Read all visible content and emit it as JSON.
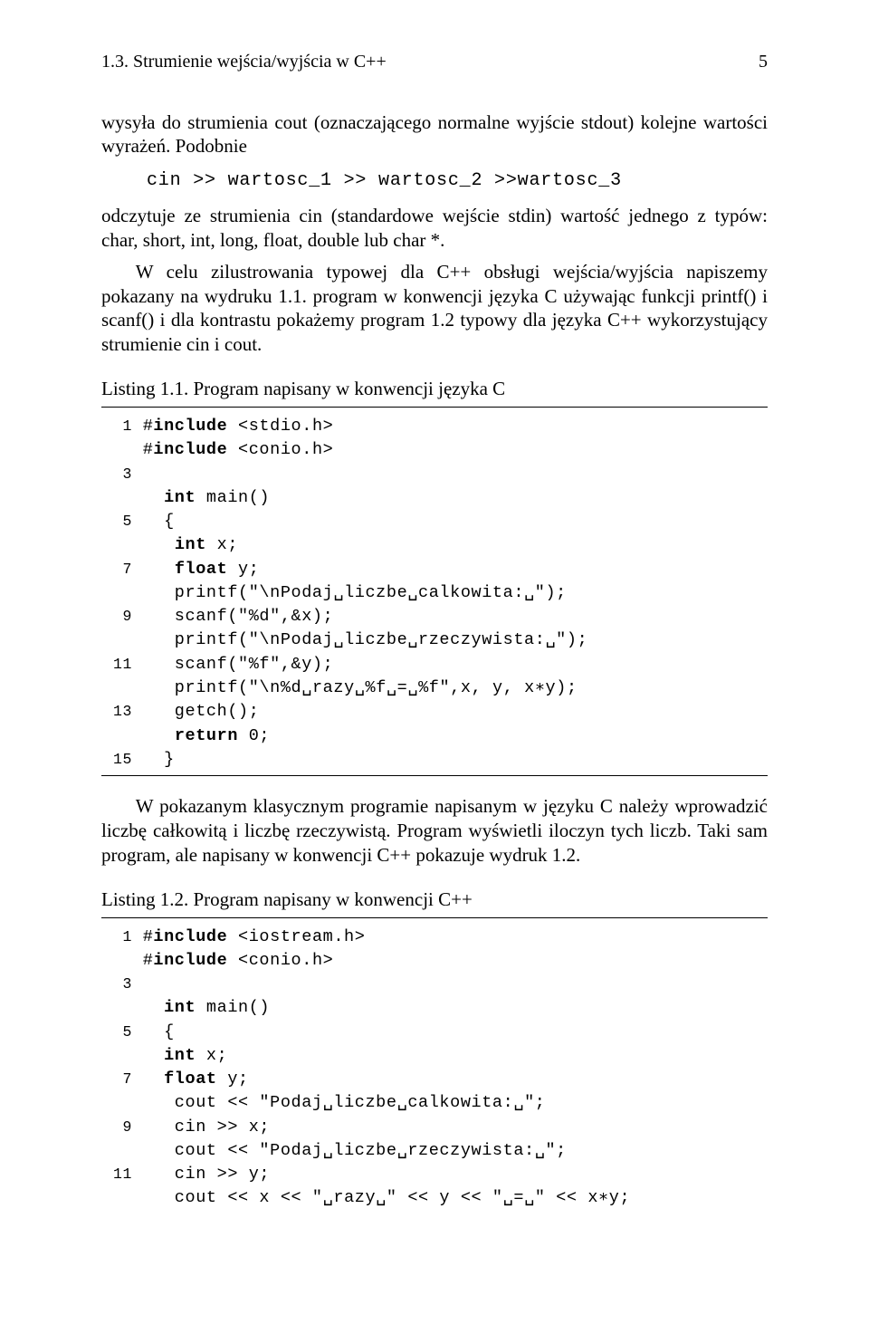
{
  "header": {
    "left": "1.3. Strumienie wejścia/wyjścia w C++",
    "right": "5"
  },
  "p1": "wysyła do strumienia cout (oznaczającego normalne wyjście stdout) kolejne wartości wyrażeń. Podobnie",
  "inline_code": "cin >> wartosc_1 >> wartosc_2 >>wartosc_3",
  "p2": "odczytuje ze strumienia cin (standardowe wejście stdin) wartość jednego z typów: char, short, int, long, float, double lub char *.",
  "p3": "W celu zilustrowania typowej dla C++ obsługi wejścia/wyjścia napiszemy pokazany na wydruku 1.1. program w konwencji języka C używając funkcji printf() i scanf() i dla kontrastu pokażemy program 1.2 typowy dla języka C++ wykorzystujący strumienie cin i cout.",
  "listing1": {
    "caption": "Listing 1.1. Program napisany w konwencji języka C",
    "lines": [
      {
        "n": "1",
        "a": "#",
        "kw": "include",
        "b": " <stdio.h>"
      },
      {
        "n": "",
        "a": "#",
        "kw": "include",
        "b": " <conio.h>"
      },
      {
        "n": "3",
        "a": "",
        "kw": "",
        "b": ""
      },
      {
        "n": "",
        "a": "  ",
        "kw": "int",
        "b": " main()"
      },
      {
        "n": "5",
        "a": "  {",
        "kw": "",
        "b": ""
      },
      {
        "n": "",
        "a": "   ",
        "kw": "int",
        "b": " x;"
      },
      {
        "n": "7",
        "a": "   ",
        "kw": "float",
        "b": " y;"
      },
      {
        "n": "",
        "a": "   printf(\"\\nPodaj␣liczbe␣calkowita:␣\");",
        "kw": "",
        "b": ""
      },
      {
        "n": "9",
        "a": "   scanf(\"%d\",&x);",
        "kw": "",
        "b": ""
      },
      {
        "n": "",
        "a": "   printf(\"\\nPodaj␣liczbe␣rzeczywista:␣\");",
        "kw": "",
        "b": ""
      },
      {
        "n": "11",
        "a": "   scanf(\"%f\",&y);",
        "kw": "",
        "b": ""
      },
      {
        "n": "",
        "a": "   printf(\"\\n%d␣razy␣%f␣=␣%f\",x, y, x∗y);",
        "kw": "",
        "b": ""
      },
      {
        "n": "13",
        "a": "   getch();",
        "kw": "",
        "b": ""
      },
      {
        "n": "",
        "a": "   ",
        "kw": "return",
        "b": " 0;"
      },
      {
        "n": "15",
        "a": "  }",
        "kw": "",
        "b": ""
      }
    ]
  },
  "p4": "W pokazanym klasycznym programie napisanym w języku C należy wprowadzić liczbę całkowitą i liczbę rzeczywistą. Program wyświetli iloczyn tych liczb. Taki sam program, ale napisany w konwencji C++ pokazuje wydruk 1.2.",
  "listing2": {
    "caption": "Listing 1.2. Program napisany w konwencji C++",
    "lines": [
      {
        "n": "1",
        "a": "#",
        "kw": "include",
        "b": " <iostream.h>"
      },
      {
        "n": "",
        "a": "#",
        "kw": "include",
        "b": " <conio.h>"
      },
      {
        "n": "3",
        "a": "",
        "kw": "",
        "b": ""
      },
      {
        "n": "",
        "a": "  ",
        "kw": "int",
        "b": " main()"
      },
      {
        "n": "5",
        "a": "  {",
        "kw": "",
        "b": ""
      },
      {
        "n": "",
        "a": "  ",
        "kw": "int",
        "b": " x;"
      },
      {
        "n": "7",
        "a": "  ",
        "kw": "float",
        "b": " y;"
      },
      {
        "n": "",
        "a": "   cout << \"Podaj␣liczbe␣calkowita:␣\";",
        "kw": "",
        "b": ""
      },
      {
        "n": "9",
        "a": "   cin >> x;",
        "kw": "",
        "b": ""
      },
      {
        "n": "",
        "a": "   cout << \"Podaj␣liczbe␣rzeczywista:␣\";",
        "kw": "",
        "b": ""
      },
      {
        "n": "11",
        "a": "   cin >> y;",
        "kw": "",
        "b": ""
      },
      {
        "n": "",
        "a": "   cout << x << \"␣razy␣\" << y << \"␣=␣\" << x∗y;",
        "kw": "",
        "b": ""
      }
    ]
  }
}
